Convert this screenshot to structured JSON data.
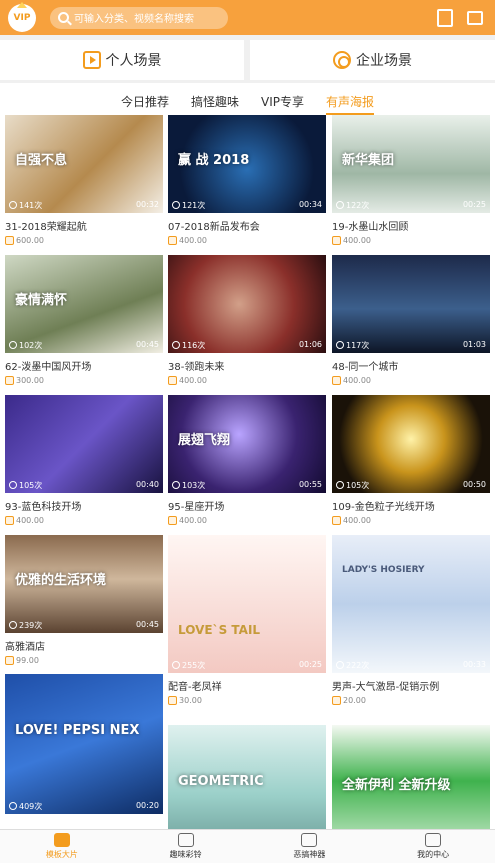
{
  "header": {
    "vip_label": "VIP",
    "search_placeholder": "可输入分类、视频名称搜索"
  },
  "scenes": {
    "personal": "个人场景",
    "enterprise": "企业场景"
  },
  "tabs": [
    {
      "label": "今日推荐",
      "active": false
    },
    {
      "label": "搞怪趣味",
      "active": false
    },
    {
      "label": "VIP专享",
      "active": false
    },
    {
      "label": "有声海报",
      "active": true
    }
  ],
  "cards": [
    {
      "title": "31-2018荣耀起航",
      "plays": "141次",
      "duration": "00:32",
      "price": "600.00",
      "overlay": "自强不息"
    },
    {
      "title": "07-2018新品发布会",
      "plays": "121次",
      "duration": "00:34",
      "price": "400.00",
      "overlay": "赢 战 2018"
    },
    {
      "title": "19-水墨山水回顾",
      "plays": "122次",
      "duration": "00:25",
      "price": "400.00",
      "overlay": "新华集团"
    },
    {
      "title": "62-泼墨中国风开场",
      "plays": "102次",
      "duration": "00:45",
      "price": "300.00",
      "overlay": "豪情满怀"
    },
    {
      "title": "38-领跑未来",
      "plays": "116次",
      "duration": "01:06",
      "price": "400.00",
      "overlay": ""
    },
    {
      "title": "48-同一个城市",
      "plays": "117次",
      "duration": "01:03",
      "price": "400.00",
      "overlay": ""
    },
    {
      "title": "93-蓝色科技开场",
      "plays": "105次",
      "duration": "00:40",
      "price": "400.00",
      "overlay": ""
    },
    {
      "title": "95-星座开场",
      "plays": "103次",
      "duration": "00:55",
      "price": "400.00",
      "overlay": "展翅飞翔"
    },
    {
      "title": "109-金色粒子光线开场",
      "plays": "105次",
      "duration": "00:50",
      "price": "400.00",
      "overlay": ""
    },
    {
      "title": "高雅酒店",
      "plays": "239次",
      "duration": "00:45",
      "price": "99.00",
      "overlay": "优雅的生活环境"
    },
    {
      "title": "配音-老凤祥",
      "plays": "255次",
      "duration": "00:25",
      "price": "30.00",
      "overlay": "LOVE`S TAIL"
    },
    {
      "title": "男声-大气激昂-促销示例",
      "plays": "222次",
      "duration": "00:33",
      "price": "20.00",
      "overlay": "LADY'S HOSIERY"
    },
    {
      "title": "",
      "plays": "409次",
      "duration": "00:20",
      "price": "",
      "overlay": "LOVE! PEPSI NEX"
    },
    {
      "title": "",
      "plays": "",
      "duration": "",
      "price": "",
      "overlay": "GEOMETRIC"
    },
    {
      "title": "",
      "plays": "",
      "duration": "",
      "price": "",
      "overlay": "全新伊利 全新升级"
    }
  ],
  "bottom_nav": [
    {
      "label": "模板大片",
      "icon": "play-film-icon",
      "active": true
    },
    {
      "label": "趣味彩铃",
      "icon": "music-bell-icon",
      "active": false
    },
    {
      "label": "恶搞神器",
      "icon": "funny-face-icon",
      "active": false
    },
    {
      "label": "我的中心",
      "icon": "user-icon",
      "active": false
    }
  ],
  "colors": {
    "accent": "#f39c1e",
    "header_bg": "#f7a13d"
  }
}
